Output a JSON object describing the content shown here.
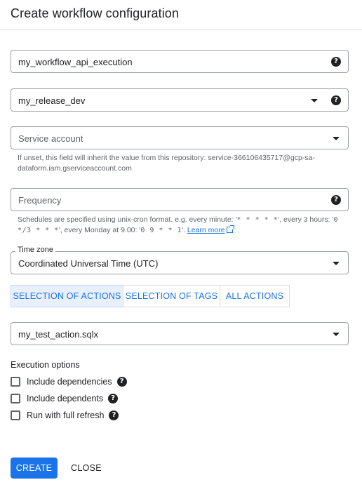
{
  "dialog": {
    "title": "Create workflow configuration"
  },
  "config_id": {
    "value": "my_workflow_api_execution",
    "help_icon": "help-icon"
  },
  "release_config": {
    "value": "my_release_dev",
    "dropdown_icon": "chevron-down-icon",
    "help_icon": "help-icon"
  },
  "service_account": {
    "placeholder": "Service account",
    "hint": "If unset, this field will inherit the value from this repository: service-366106435717@gcp-sa-dataform.iam.gserviceaccount.com"
  },
  "frequency": {
    "placeholder": "Frequency",
    "hint_part1": "Schedules are specified using unix-cron format. e.g. every minute: '",
    "hint_code1": "* * * * *",
    "hint_part2": "', every 3 hours: '",
    "hint_code2": "0 */3 * * *",
    "hint_part3": "', every Monday at 9.00: '",
    "hint_code3": "0 9 * * 1",
    "hint_part4": "'. ",
    "learn_more": "Learn more",
    "learn_more_icon": "open-in-new-icon"
  },
  "time_zone": {
    "label": "Time zone",
    "value": "Coordinated Universal Time (UTC)"
  },
  "action_scope": {
    "options": [
      "SELECTION OF ACTIONS",
      "SELECTION OF TAGS",
      "ALL ACTIONS"
    ],
    "selected": "SELECTION OF ACTIONS"
  },
  "actions_select": {
    "value": "my_test_action.sqlx"
  },
  "execution_options": {
    "title": "Execution options",
    "items": [
      {
        "label": "Include dependencies",
        "checked": false
      },
      {
        "label": "Include dependents",
        "checked": false
      },
      {
        "label": "Run with full refresh",
        "checked": false
      }
    ]
  },
  "footer": {
    "create_label": "CREATE",
    "close_label": "CLOSE"
  },
  "colors": {
    "accent": "#1a73e8",
    "selected_bg": "#e8f0fe",
    "hint_text": "#5f6368"
  }
}
